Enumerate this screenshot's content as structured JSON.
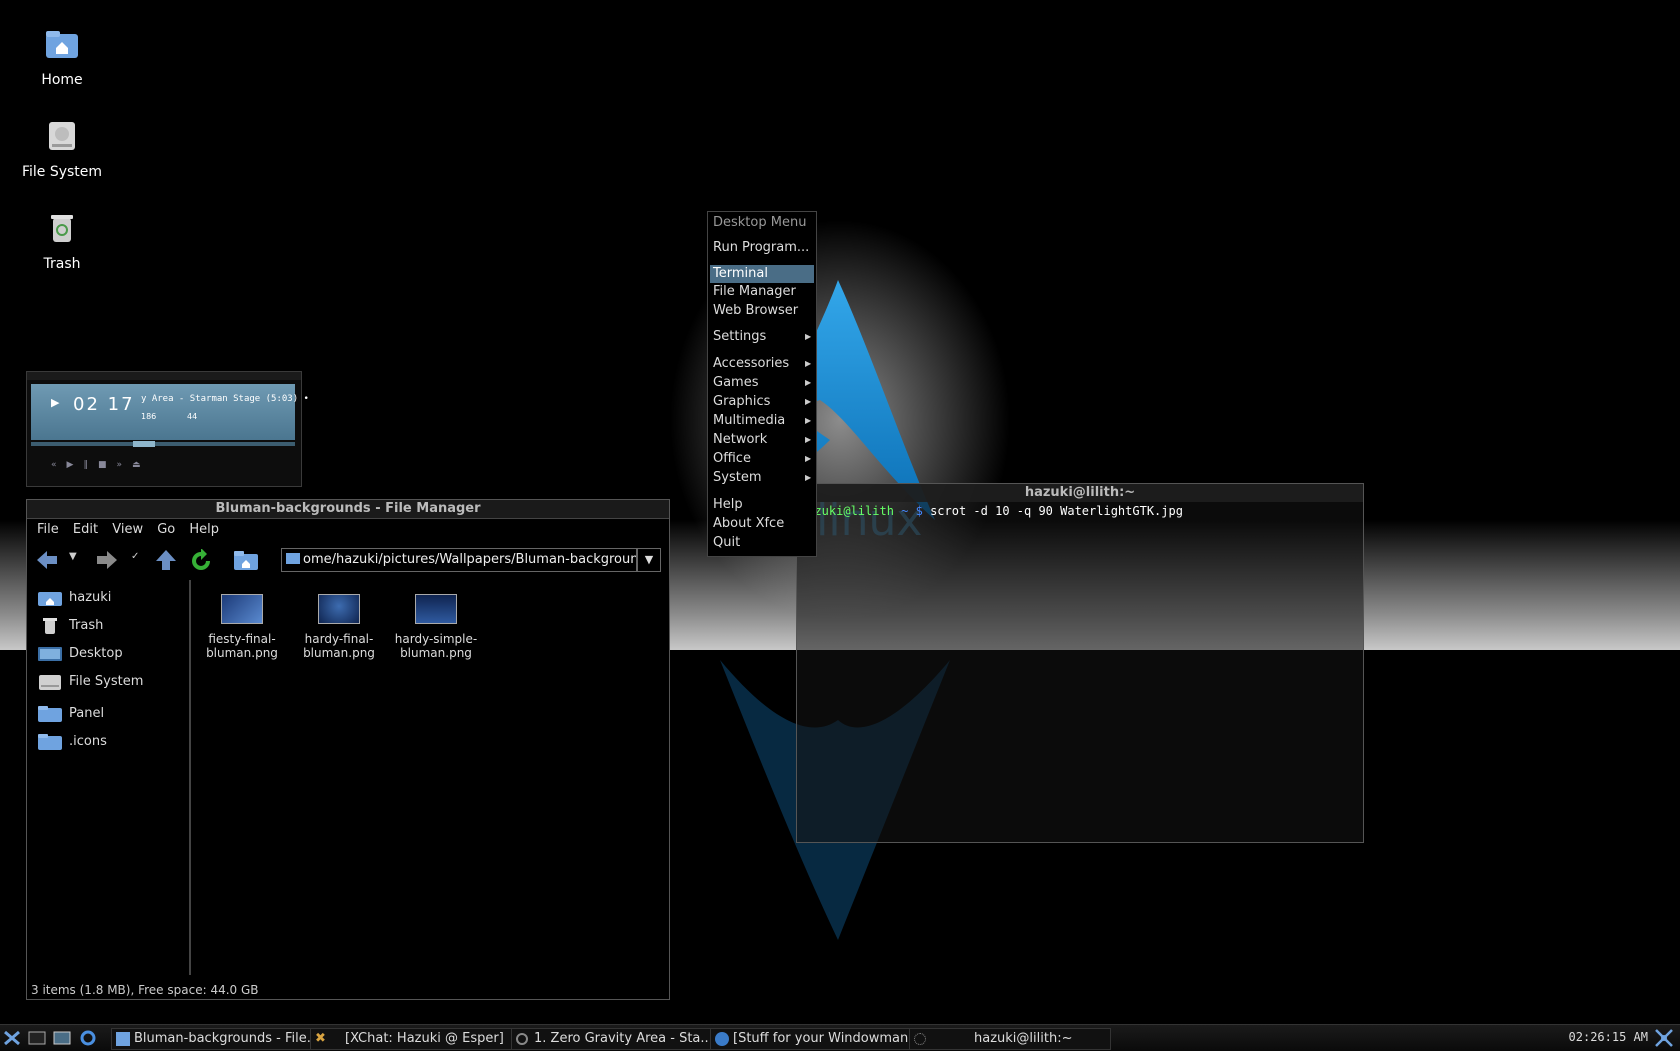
{
  "desktop": {
    "icons": [
      {
        "label": "Home",
        "icon": "home-folder-icon"
      },
      {
        "label": "File System",
        "icon": "hard-drive-icon"
      },
      {
        "label": "Trash",
        "icon": "trash-icon"
      }
    ],
    "wallpaper": {
      "logo_text": "archlinux"
    }
  },
  "media_player": {
    "time": "02 17",
    "song": "y Area - Starman Stage (5:03) •",
    "kbps": "186",
    "khz": "44",
    "seek_progress": 0.42
  },
  "file_manager": {
    "title": "Bluman-backgrounds - File Manager",
    "menu": [
      "File",
      "Edit",
      "View",
      "Go",
      "Help"
    ],
    "location": "ome/hazuki/pictures/Wallpapers/Bluman-backgrounds",
    "sidebar": [
      {
        "label": "hazuki",
        "icon": "home-folder-icon"
      },
      {
        "label": "Trash",
        "icon": "trash-icon"
      },
      {
        "label": "Desktop",
        "icon": "desktop-icon"
      },
      {
        "label": "File System",
        "icon": "hard-drive-icon"
      },
      {
        "label": "Panel",
        "icon": "folder-icon"
      },
      {
        "label": ".icons",
        "icon": "folder-icon"
      }
    ],
    "files": [
      {
        "line1": "fiesty-final-",
        "line2": "bluman.png"
      },
      {
        "line1": "hardy-final-",
        "line2": "bluman.png"
      },
      {
        "line1": "hardy-simple-",
        "line2": "bluman.png"
      }
    ],
    "status": "3 items (1.8 MB), Free space: 44.0 GB"
  },
  "terminal": {
    "title": "hazuki@lilith:~",
    "prompt_user": "hazuki@lilith",
    "prompt_symbol": "~ $",
    "command": "scrot -d 10 -q 90 WaterlightGTK.jpg"
  },
  "desktop_menu": {
    "header": "Desktop Menu",
    "items": [
      {
        "label": "Run Program..."
      },
      {
        "label": "Terminal",
        "selected": true
      },
      {
        "label": "File Manager"
      },
      {
        "label": "Web Browser"
      },
      {
        "label": "Settings",
        "submenu": true
      },
      {
        "label": "Accessories",
        "submenu": true
      },
      {
        "label": "Games",
        "submenu": true
      },
      {
        "label": "Graphics",
        "submenu": true
      },
      {
        "label": "Multimedia",
        "submenu": true
      },
      {
        "label": "Network",
        "submenu": true
      },
      {
        "label": "Office",
        "submenu": true
      },
      {
        "label": "System",
        "submenu": true
      },
      {
        "label": "Help"
      },
      {
        "label": "About Xfce"
      },
      {
        "label": "Quit"
      }
    ]
  },
  "taskbar": {
    "tasks": [
      {
        "label": "Bluman-backgrounds - File..."
      },
      {
        "label": "[XChat: Hazuki @ Esper]"
      },
      {
        "label": "1. Zero Gravity Area - Sta..."
      },
      {
        "label": "[Stuff for your Windowman..."
      },
      {
        "label": "hazuki@lilith:~"
      }
    ],
    "clock": "02:26:15 AM"
  }
}
